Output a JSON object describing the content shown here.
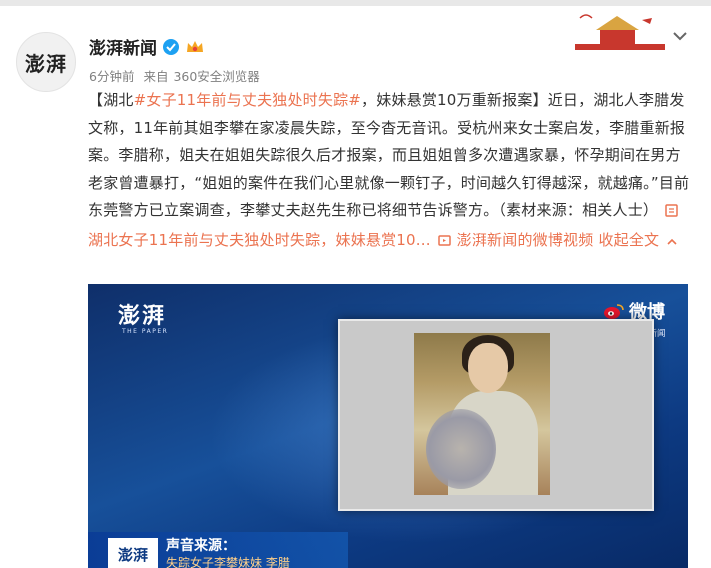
{
  "author": {
    "name": "澎湃新闻",
    "avatar_text": "澎湃"
  },
  "meta": {
    "time": "6分钟前",
    "source_prefix": "来自",
    "source": "360安全浏览器"
  },
  "post": {
    "p1": "【湖北",
    "hashtag": "#女子11年前与丈夫独处时失踪#",
    "p2": "，妹妹悬赏10万重新报案】近日，湖北人李腊发文称，11年前其姐李攀在家凌晨失踪，至今杳无音讯。受杭州来女士案启发，李腊重新报案。李腊称，姐夫在姐姐失踪很久后才报案，而且姐姐曾多次遭遇家暴，怀孕期间在男方老家曾遭暴打，“姐姐的案件在我们心里就像一颗钉子，时间越久钉得越深，就越痛。”目前东莞警方已立案调查，李攀丈夫赵先生称已将细节告诉警方。（素材来源：相关人士）",
    "article_link": "湖北女子11年前与丈夫独处时失踪，妹妹悬赏10...",
    "video_link": "澎湃新闻的微博视频",
    "collapse": "收起全文"
  },
  "video": {
    "logo": "澎湃",
    "logo_sub": "THE PAPER",
    "weibo": "微博",
    "handle": "@澎湃新闻",
    "caption_logo": "澎湃",
    "caption_title": "声音来源：",
    "caption_sub": "失踪女子李攀妹妹 李腊"
  },
  "colors": {
    "accent": "#eb7350",
    "verified": "#1da1f2"
  }
}
